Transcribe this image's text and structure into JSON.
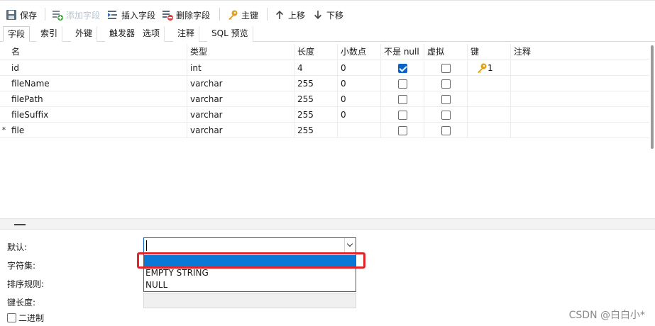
{
  "toolbar": {
    "save": "保存",
    "add_field": "添加字段",
    "insert_field": "插入字段",
    "delete_field": "删除字段",
    "primary_key": "主键",
    "move_up": "上移",
    "move_down": "下移"
  },
  "tabs": [
    "字段",
    "索引",
    "外键",
    "触发器",
    "选项",
    "注释",
    "SQL 预览"
  ],
  "columns": [
    "名",
    "类型",
    "长度",
    "小数点",
    "不是 null",
    "虚拟",
    "键",
    "注释"
  ],
  "rows": [
    {
      "marker": "",
      "name": "id",
      "type": "int",
      "length": "4",
      "decimals": "0",
      "not_null": true,
      "virtual": false,
      "key": "1",
      "comment": ""
    },
    {
      "marker": "",
      "name": "fileName",
      "type": "varchar",
      "length": "255",
      "decimals": "0",
      "not_null": false,
      "virtual": false,
      "key": "",
      "comment": ""
    },
    {
      "marker": "",
      "name": "filePath",
      "type": "varchar",
      "length": "255",
      "decimals": "0",
      "not_null": false,
      "virtual": false,
      "key": "",
      "comment": ""
    },
    {
      "marker": "",
      "name": "fileSuffix",
      "type": "varchar",
      "length": "255",
      "decimals": "0",
      "not_null": false,
      "virtual": false,
      "key": "",
      "comment": ""
    },
    {
      "marker": "*",
      "name": "file",
      "type": "varchar",
      "length": "255",
      "decimals": "",
      "not_null": false,
      "virtual": false,
      "key": "",
      "comment": ""
    }
  ],
  "props": {
    "default_label": "默认:",
    "charset_label": "字符集:",
    "collation_label": "排序规则:",
    "key_length_label": "键长度:",
    "binary_label": "二进制",
    "default_value": "",
    "options": [
      "",
      "EMPTY STRING",
      "NULL"
    ]
  },
  "watermark": "CSDN @白白小*",
  "colors": {
    "accent": "#0a64c8",
    "selection": "#0a78d7",
    "highlight": "#e0262b",
    "key": "#e0a21a"
  }
}
